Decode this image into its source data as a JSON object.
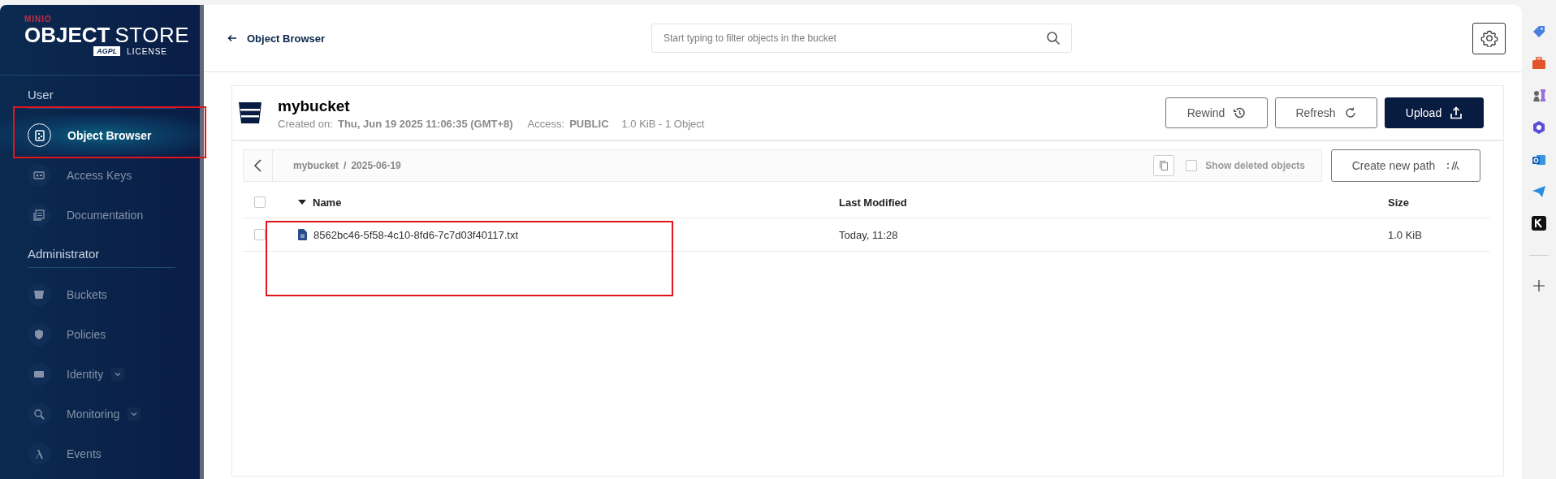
{
  "sidebar": {
    "logo": {
      "brand": "MINIO",
      "product_bold": "OBJECT",
      "product_light": "STORE",
      "badge": "AGPL",
      "license": "LICENSE"
    },
    "sections": [
      {
        "title": "User",
        "items": [
          {
            "label": "Object Browser",
            "kind": "object",
            "selected": true,
            "has_submenu": false
          },
          {
            "label": "Access Keys",
            "kind": "keys",
            "selected": false,
            "has_submenu": false
          },
          {
            "label": "Documentation",
            "kind": "docs",
            "selected": false,
            "has_submenu": false
          }
        ]
      },
      {
        "title": "Administrator",
        "items": [
          {
            "label": "Buckets",
            "kind": "bucket",
            "selected": false,
            "has_submenu": false
          },
          {
            "label": "Policies",
            "kind": "shield",
            "selected": false,
            "has_submenu": false
          },
          {
            "label": "Identity",
            "kind": "id",
            "selected": false,
            "has_submenu": true
          },
          {
            "label": "Monitoring",
            "kind": "monitor",
            "selected": false,
            "has_submenu": true
          },
          {
            "label": "Events",
            "kind": "lambda",
            "selected": false,
            "has_submenu": false
          }
        ]
      }
    ]
  },
  "header": {
    "back_label": "Object Browser",
    "search": {
      "placeholder": "Start typing to filter objects in the bucket"
    }
  },
  "bucket": {
    "name": "mybucket",
    "created_label": "Created on:",
    "created": "Thu, Jun 19 2025 11:06:35 (GMT+8)",
    "access_label": "Access:",
    "access": "PUBLIC",
    "usage": "1.0 KiB - 1 Object",
    "buttons": [
      {
        "label": "Rewind",
        "kind": "rewind"
      },
      {
        "label": "Refresh",
        "kind": "refresh"
      },
      {
        "label": "Upload",
        "kind": "upload"
      }
    ]
  },
  "path": {
    "segments": [
      "mybucket",
      "2025-06-19"
    ],
    "separator": "/",
    "show_deleted": {
      "label": "Show deleted objects",
      "checked": false
    },
    "create_button": "Create new path"
  },
  "table": {
    "columns": [
      {
        "label": "Name",
        "sorted": true
      },
      {
        "label": "Last Modified",
        "sorted": false
      },
      {
        "label": "Size",
        "sorted": false
      }
    ],
    "all_checked": false,
    "rows": [
      {
        "name": "8562bc46-5f58-4c10-8fd6-7c7d03f40117.txt",
        "modified": "Today, 11:28",
        "size": "1.0 KiB",
        "checked": false
      }
    ]
  }
}
